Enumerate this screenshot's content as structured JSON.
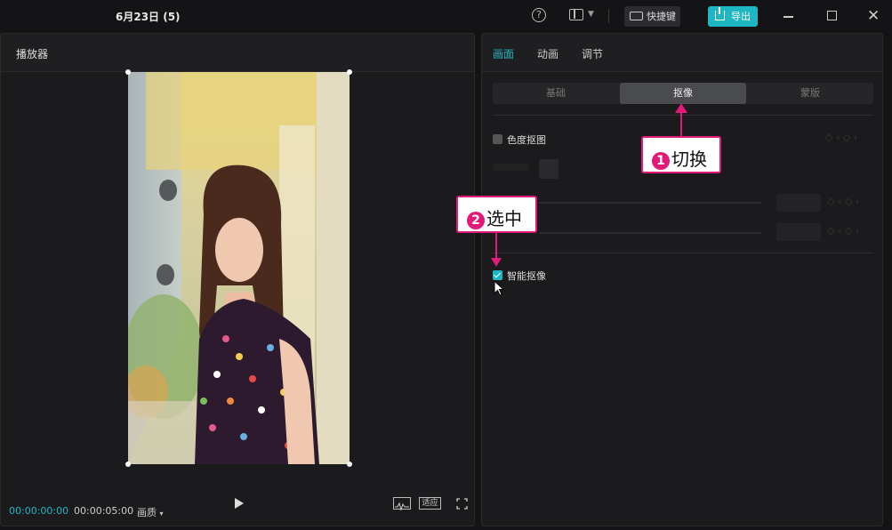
{
  "window": {
    "title": "6月23日 (5)",
    "shortcut_label": "快捷键",
    "export_label": "导出",
    "accent": "#1fb6c3"
  },
  "player": {
    "title": "播放器",
    "current_time": "00:00:00:00",
    "duration": "00:00:05:00",
    "quality_label": "画质",
    "fit_label": "适应"
  },
  "panel": {
    "tabs": [
      {
        "label": "画面",
        "active": true
      },
      {
        "label": "动画",
        "active": false
      },
      {
        "label": "调节",
        "active": false
      }
    ],
    "segments": [
      {
        "label": "基础",
        "active": false
      },
      {
        "label": "抠像",
        "active": true
      },
      {
        "label": "蒙版",
        "active": false
      }
    ],
    "chroma_key": {
      "label": "色度抠图",
      "checked": false
    },
    "smart_cutout": {
      "label": "智能抠像",
      "checked": true
    }
  },
  "annotations": {
    "step1": {
      "number": "1",
      "text": "切换"
    },
    "step2": {
      "number": "2",
      "text": "选中"
    },
    "color": "#e2187a"
  }
}
